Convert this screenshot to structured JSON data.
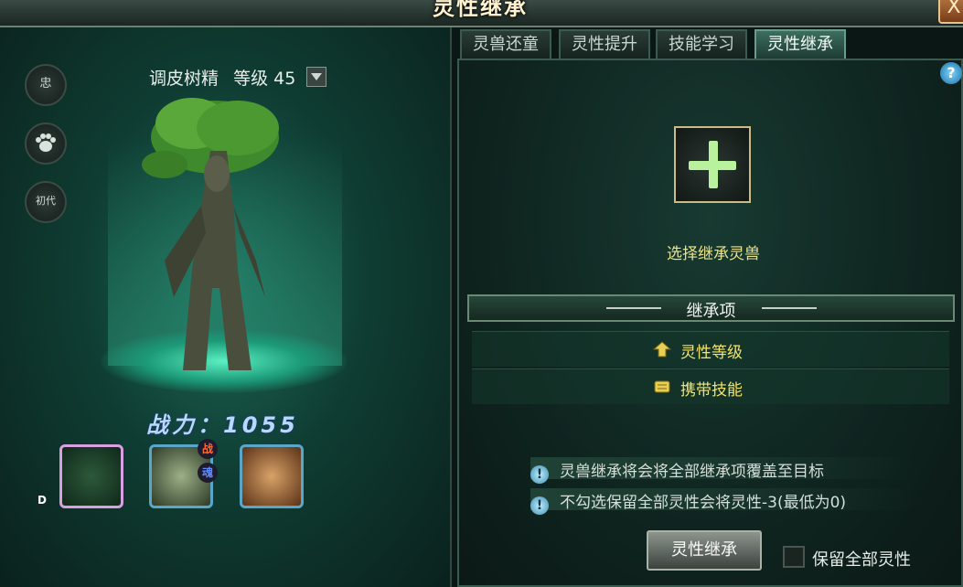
{
  "window": {
    "title": "灵性继承",
    "close_label": "X"
  },
  "left_panel": {
    "side_icons": [
      {
        "label": "忠",
        "icon": "loyalty-icon"
      },
      {
        "label": "",
        "icon": "paw-icon"
      },
      {
        "label": "初代",
        "icon": "generation-icon"
      }
    ],
    "pet_name": "调皮树精",
    "level_label": "等级 45",
    "power_label": "战力：1055",
    "slot_badges": {
      "top": "战",
      "bottom": "魂"
    },
    "slot_letter": "D"
  },
  "tabs": [
    {
      "label": "灵兽还童",
      "active": false
    },
    {
      "label": "灵性提升",
      "active": false
    },
    {
      "label": "技能学习",
      "active": false
    },
    {
      "label": "灵性继承",
      "active": true
    }
  ],
  "help_label": "?",
  "inherit_panel": {
    "choose_label": "选择继承灵兽",
    "section_title": "继承项",
    "items": [
      {
        "label": "灵性等级",
        "icon": "level-up-icon"
      },
      {
        "label": "携带技能",
        "icon": "skill-scroll-icon"
      }
    ],
    "notes": [
      "灵兽继承将会将全部继承项覆盖至目标",
      "不勾选保留全部灵性会将灵性-3(最低为0)"
    ],
    "inherit_button": "灵性继承",
    "keep_label": "保留全部灵性",
    "keep_checked": false
  }
}
